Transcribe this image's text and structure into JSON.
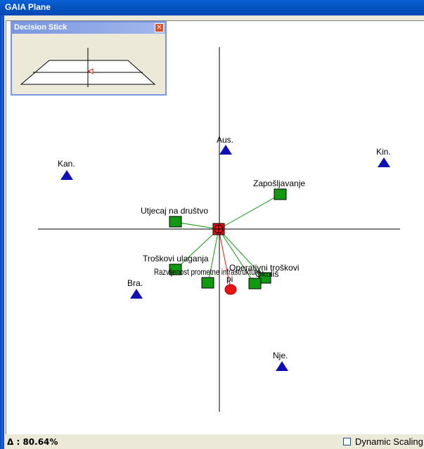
{
  "window": {
    "title": "GAIA Plane"
  },
  "decision_stick": {
    "title": "Decision Stick",
    "close_glyph": "✕"
  },
  "status": {
    "delta": "Δ : 80.64%",
    "dynamic_scaling_label": "Dynamic Scaling",
    "dynamic_scaling_checked": false
  },
  "alternatives": [
    {
      "name": "Aus."
    },
    {
      "name": "Kin."
    },
    {
      "name": "Kan."
    },
    {
      "name": "Bra."
    },
    {
      "name": "Nje."
    }
  ],
  "criteria": [
    {
      "name": "Zapošljavanje"
    },
    {
      "name": "Utjecaj na društvo"
    },
    {
      "name": "Troškovi ulaganja"
    },
    {
      "name": "Razvijenost prometne infrastrukture"
    },
    {
      "name": "Operativni troškovi"
    },
    {
      "name": "Okoliš"
    },
    {
      "name": "pi"
    }
  ],
  "colors": {
    "alternative": "#0f0fb4",
    "criterion": "#119a11",
    "decision_axis": "#e61414",
    "title_bar": "#0453c2"
  }
}
